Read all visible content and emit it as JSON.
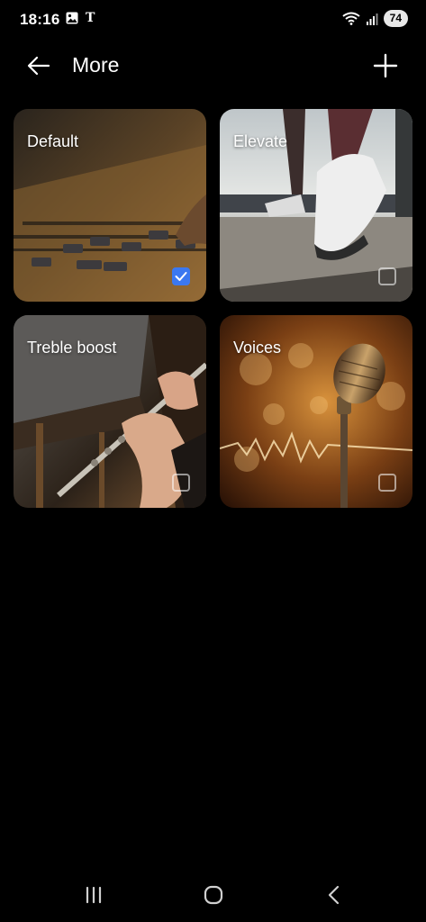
{
  "status_bar": {
    "time": "18:16",
    "carrier_icon": "T",
    "battery": "74"
  },
  "header": {
    "title": "More"
  },
  "presets": [
    {
      "label": "Default",
      "checked": true
    },
    {
      "label": "Elevate",
      "checked": false
    },
    {
      "label": "Treble boost",
      "checked": false
    },
    {
      "label": "Voices",
      "checked": false
    }
  ],
  "colors": {
    "background": "#000000",
    "accent": "#3b78f0"
  }
}
